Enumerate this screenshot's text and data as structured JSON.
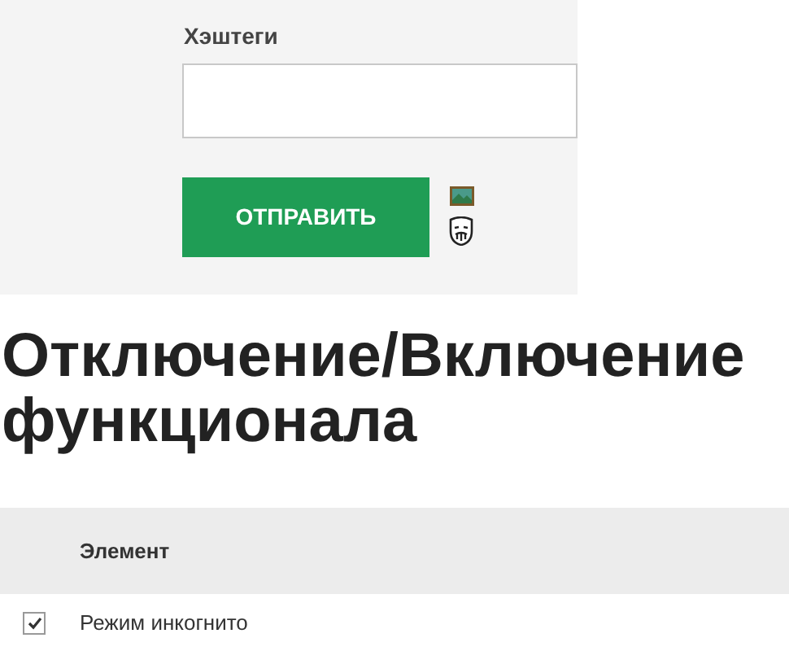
{
  "form": {
    "hashtags_label": "Хэштеги",
    "submit_button": "ОТПРАВИТЬ"
  },
  "heading": "Отключение/Включение функционала",
  "table": {
    "columns": [
      "Элемент"
    ],
    "rows": [
      {
        "label": "Режим инкогнито",
        "checked": true
      }
    ]
  }
}
